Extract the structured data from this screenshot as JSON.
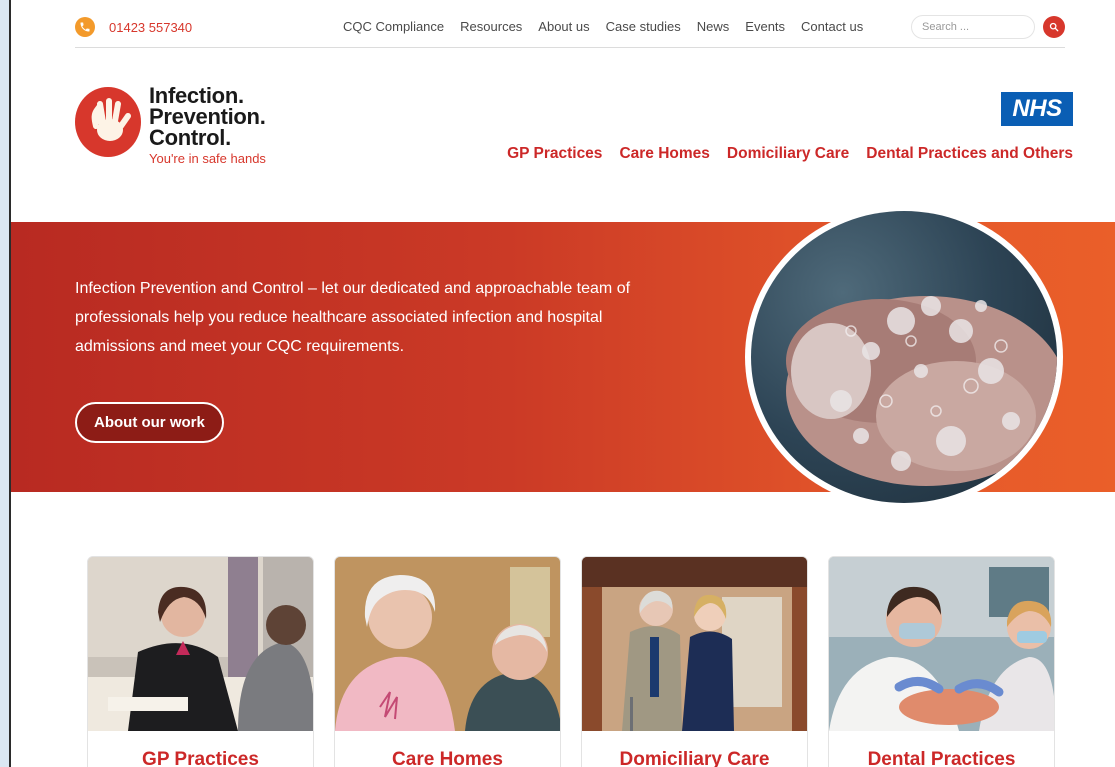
{
  "topbar": {
    "phone": "01423 557340",
    "nav": [
      "CQC Compliance",
      "Resources",
      "About us",
      "Case studies",
      "News",
      "Events",
      "Contact us"
    ],
    "search_placeholder": "Search ..."
  },
  "header": {
    "logo_lines": [
      "Infection.",
      "Prevention.",
      "Control."
    ],
    "logo_tagline": "You're in safe hands",
    "nhs_label": "NHS",
    "nav": [
      "GP Practices",
      "Care Homes",
      "Domiciliary Care",
      "Dental Practices and Others"
    ]
  },
  "hero": {
    "text": "Infection Prevention and Control – let our dedicated and approachable team of professionals help you reduce healthcare associated infection and hospital admissions and meet your CQC requirements.",
    "button": "About our work"
  },
  "cards": [
    {
      "title": "GP Practices"
    },
    {
      "title": "Care Homes"
    },
    {
      "title": "Domiciliary Care"
    },
    {
      "title": "Dental Practices"
    }
  ],
  "colors": {
    "brand_red": "#d7372c",
    "nav_red": "#cc2828",
    "nhs_blue": "#0a5eb4",
    "phone_orange": "#f39a2b"
  },
  "icons": {
    "phone": "phone-icon",
    "search": "search-icon",
    "logo": "hand-icon"
  }
}
